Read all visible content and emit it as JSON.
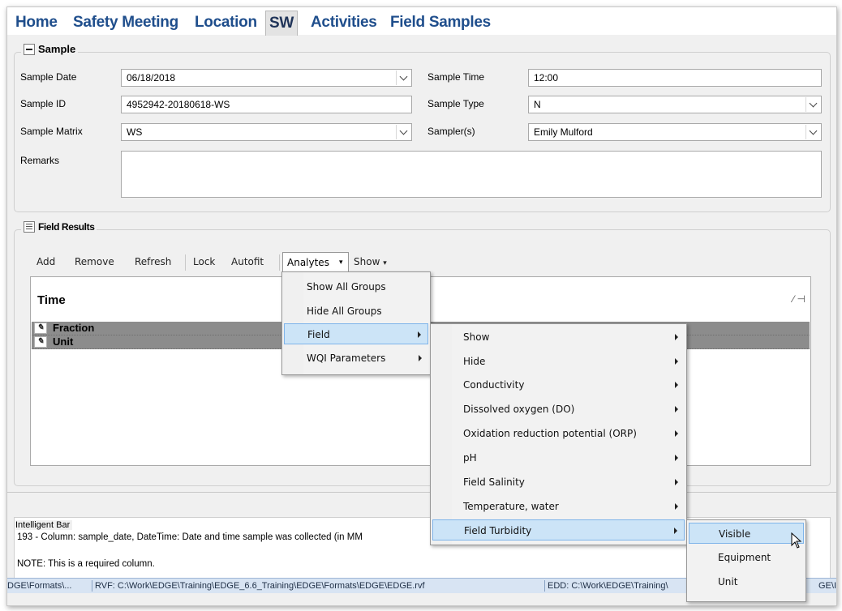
{
  "tabs": [
    {
      "label": "Home"
    },
    {
      "label": "Safety Meeting"
    },
    {
      "label": "Location"
    },
    {
      "label": "SW"
    },
    {
      "label": "Activities"
    },
    {
      "label": "Field Samples"
    }
  ],
  "sample_group": {
    "title": "Sample",
    "sample_date": {
      "label": "Sample Date",
      "value": "06/18/2018"
    },
    "sample_id": {
      "label": "Sample ID",
      "value": "4952942-20180618-WS"
    },
    "sample_matrix": {
      "label": "Sample Matrix",
      "value": "WS"
    },
    "sample_time": {
      "label": "Sample Time",
      "value": "12:00"
    },
    "sample_type": {
      "label": "Sample Type",
      "value": "N"
    },
    "samplers": {
      "label": "Sampler(s)",
      "value": "Emily Mulford"
    },
    "remarks": {
      "label": "Remarks",
      "value": ""
    }
  },
  "field_results": {
    "title": "Field Results",
    "toolbar": {
      "add": "Add",
      "remove": "Remove",
      "refresh": "Refresh",
      "lock": "Lock",
      "autofit": "Autofit",
      "analytes": "Analytes",
      "show": "Show"
    },
    "grid_header": "Time",
    "rows": [
      {
        "label": "Fraction"
      },
      {
        "label": "Unit"
      }
    ]
  },
  "menus": {
    "analytes": [
      "Show All Groups",
      "Hide All Groups",
      "Field",
      "WQI Parameters"
    ],
    "field": [
      "Show",
      "Hide",
      "Conductivity",
      "Dissolved oxygen (DO)",
      "Oxidation reduction potential (ORP)",
      "pH",
      "Field Salinity",
      "Temperature, water",
      "Field Turbidity"
    ],
    "turbidity": [
      "Visible",
      "Equipment",
      "Unit"
    ]
  },
  "intelligent_bar": {
    "title": "Intelligent Bar",
    "line1": "193 - Column: sample_date, DateTime: Date and time sample was collected (in MM",
    "line2": "NOTE: This is a required column."
  },
  "status_bar": {
    "seg1": "DGE\\Formats\\...",
    "seg2": "RVF: C:\\Work\\EDGE\\Training\\EDGE_6.6_Training\\EDGE\\Formats\\EDGE\\EDGE.rvf",
    "seg3": "EDD: C:\\Work\\EDGE\\Training\\",
    "seg4": "GE\\I"
  },
  "colors": {
    "tab_text": "#1f4e8c",
    "menu_highlight": "#cce4f7",
    "grid_row": "#8c8c8c",
    "status_bg": "#d8e4f3"
  }
}
